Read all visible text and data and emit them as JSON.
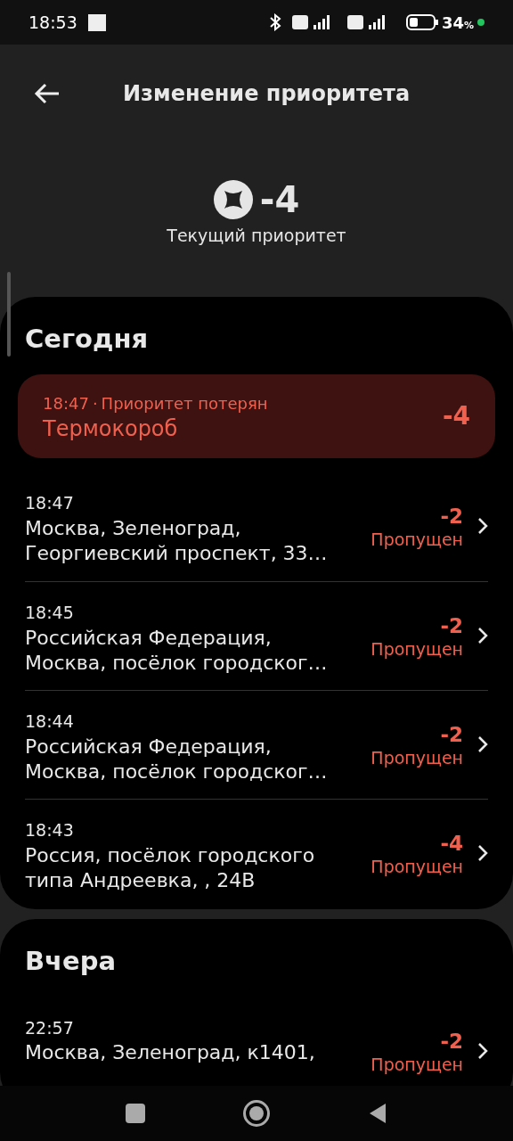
{
  "status_bar": {
    "time": "18:53",
    "battery": "34",
    "battery_unit": "%"
  },
  "header": {
    "title": "Изменение приоритета"
  },
  "priority": {
    "value": "-4",
    "label": "Текущий приоритет"
  },
  "sections": [
    {
      "title": "Сегодня",
      "items": [
        {
          "kind": "alert",
          "time": "18:47",
          "separator": "·",
          "reason": "Приоритет потерян",
          "title": "Термокороб",
          "delta": "-4"
        },
        {
          "kind": "visit",
          "time": "18:47",
          "address": "Москва, Зеленоград, Георгиевский проспект, 33…",
          "delta": "-2",
          "status": "Пропущен"
        },
        {
          "kind": "visit",
          "time": "18:45",
          "address": "Российская Федерация, Москва, посёлок городског…",
          "delta": "-2",
          "status": "Пропущен"
        },
        {
          "kind": "visit",
          "time": "18:44",
          "address": "Российская Федерация, Москва, посёлок городског…",
          "delta": "-2",
          "status": "Пропущен"
        },
        {
          "kind": "visit",
          "time": "18:43",
          "address": "Россия, посёлок городского типа Андреевка, , 24В",
          "delta": "-4",
          "status": "Пропущен"
        }
      ]
    },
    {
      "title": "Вчера",
      "items": [
        {
          "kind": "visit",
          "time": "22:57",
          "address": "Москва, Зеленоград, к1401,",
          "delta": "-2",
          "status": "Пропущен"
        }
      ]
    }
  ]
}
